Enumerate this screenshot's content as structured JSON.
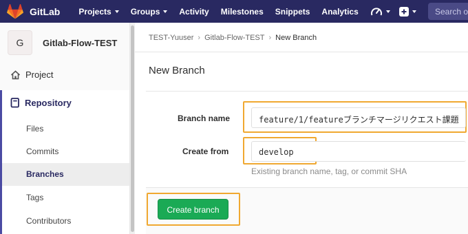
{
  "brand": {
    "name": "GitLab"
  },
  "nav": {
    "items": [
      {
        "label": "Projects",
        "dropdown": true
      },
      {
        "label": "Groups",
        "dropdown": true
      },
      {
        "label": "Activity",
        "dropdown": false
      },
      {
        "label": "Milestones",
        "dropdown": false
      },
      {
        "label": "Snippets",
        "dropdown": false
      },
      {
        "label": "Analytics",
        "dropdown": false
      }
    ],
    "icons": [
      "dashboard-icon",
      "plus-square-icon"
    ],
    "search_placeholder": "Search o"
  },
  "sidebar": {
    "avatar_letter": "G",
    "project_name": "Gitlab-Flow-TEST",
    "project_label": "Project",
    "repository_label": "Repository",
    "sub_items": [
      "Files",
      "Commits",
      "Branches",
      "Tags",
      "Contributors"
    ],
    "active_sub_item": "Branches"
  },
  "breadcrumb": [
    "TEST-Yuuser",
    "Gitlab-Flow-TEST",
    "New Branch"
  ],
  "page": {
    "title": "New Branch"
  },
  "form": {
    "branch_name_label": "Branch name",
    "branch_name_value": "feature/1/featureブランチマージリクエスト課題",
    "create_from_label": "Create from",
    "create_from_value": "develop",
    "create_from_help": "Existing branch name, tag, or commit SHA",
    "submit_label": "Create branch"
  },
  "colors": {
    "topbar": "#292961",
    "highlight": "#f0a830",
    "button": "#1aaa55",
    "active_nav": "#4b4ba3"
  }
}
